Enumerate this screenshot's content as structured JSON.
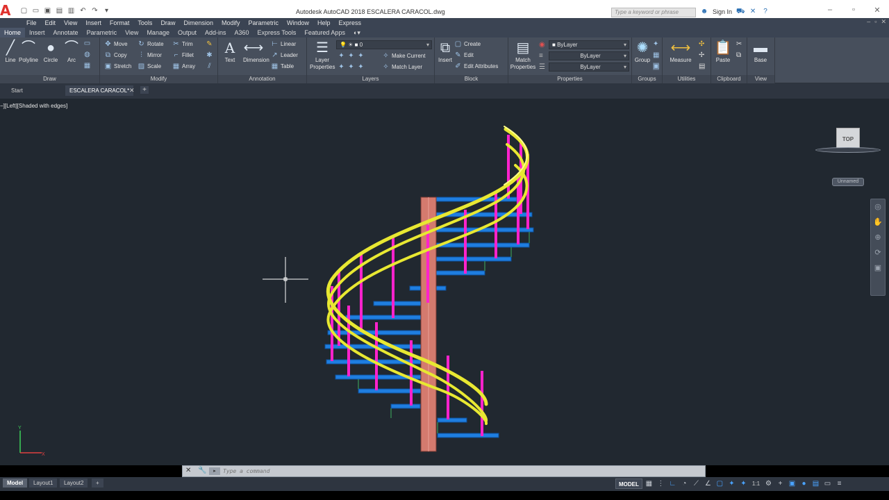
{
  "app": {
    "logo": "A",
    "title": "Autodesk AutoCAD 2018    ESCALERA CARACOL.dwg",
    "search_placeholder": "Type a keyword or phrase",
    "sign_in": "Sign In"
  },
  "menu": [
    "File",
    "Edit",
    "View",
    "Insert",
    "Format",
    "Tools",
    "Draw",
    "Dimension",
    "Modify",
    "Parametric",
    "Window",
    "Help",
    "Express"
  ],
  "ribbon_tabs": [
    "Home",
    "Insert",
    "Annotate",
    "Parametric",
    "View",
    "Manage",
    "Output",
    "Add-ins",
    "A360",
    "Express Tools",
    "Featured Apps"
  ],
  "ribbon_active_tab": "Home",
  "draw_panel": {
    "title": "Draw",
    "line": "Line",
    "polyline": "Polyline",
    "circle": "Circle",
    "arc": "Arc"
  },
  "modify_panel": {
    "title": "Modify",
    "move": "Move",
    "rotate": "Rotate",
    "trim": "Trim",
    "copy": "Copy",
    "mirror": "Mirror",
    "fillet": "Fillet",
    "stretch": "Stretch",
    "scale": "Scale",
    "array": "Array"
  },
  "annotation_panel": {
    "title": "Annotation",
    "text": "Text",
    "dimension": "Dimension",
    "linear": "Linear",
    "leader": "Leader",
    "table": "Table"
  },
  "layers_panel": {
    "title": "Layers",
    "layer_properties": "Layer\nProperties",
    "current_layer": "0",
    "make_current": "Make Current",
    "match_layer": "Match Layer"
  },
  "block_panel": {
    "title": "Block",
    "insert": "Insert",
    "create": "Create",
    "edit": "Edit",
    "edit_attributes": "Edit Attributes"
  },
  "properties_panel": {
    "title": "Properties",
    "match_properties": "Match\nProperties",
    "color": "ByLayer",
    "linetype": "ByLayer",
    "lineweight": "ByLayer"
  },
  "groups_panel": {
    "title": "Groups",
    "group": "Group"
  },
  "utilities_panel": {
    "title": "Utilities",
    "measure": "Measure"
  },
  "clipboard_panel": {
    "title": "Clipboard",
    "paste": "Paste"
  },
  "view_panel": {
    "title": "View",
    "base": "Base"
  },
  "doc_tabs": [
    "Start",
    "ESCALERA CARACOL*"
  ],
  "viewport": {
    "label": "−][Left][Shaded with edges]",
    "viewcube_face": "TOP",
    "wcs_label": "Unnamed"
  },
  "command_line": {
    "placeholder": "Type a command"
  },
  "layout_tabs": [
    "Model",
    "Layout1",
    "Layout2"
  ],
  "status": {
    "model": "MODEL",
    "scale": "1:1"
  },
  "colors": {
    "viewport_bg": "#212830",
    "railing": "#e8e832",
    "balusters": "#ff22cc",
    "steps": "#1f7ee0",
    "column": "#d47a6e"
  }
}
